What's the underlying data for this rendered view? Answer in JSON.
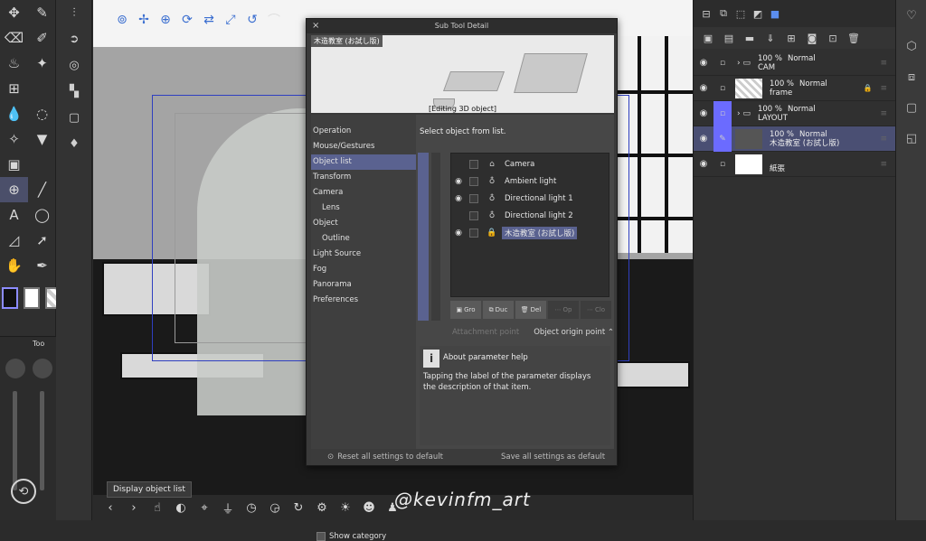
{
  "dialog": {
    "title": "Sub Tool Detail",
    "close_icon": "×",
    "preview_name": "木造教室 (お試し版)",
    "preview_label": "[Editing 3D object]",
    "categories": [
      {
        "label": "Operation",
        "indent": false
      },
      {
        "label": "Mouse/Gestures",
        "indent": false
      },
      {
        "label": "Object list",
        "indent": false,
        "selected": true
      },
      {
        "label": "Transform",
        "indent": false
      },
      {
        "label": "Camera",
        "indent": false
      },
      {
        "label": "Lens",
        "indent": true
      },
      {
        "label": "Object",
        "indent": false
      },
      {
        "label": "Outline",
        "indent": true
      },
      {
        "label": "Light Source",
        "indent": false
      },
      {
        "label": "Fog",
        "indent": false
      },
      {
        "label": "Panorama",
        "indent": false
      },
      {
        "label": "Preferences",
        "indent": false
      }
    ],
    "show_category": "Show category",
    "select_message": "Select object from list.",
    "objects": [
      {
        "label": "Camera",
        "icon": "camera-icon",
        "eye": false
      },
      {
        "label": "Ambient light",
        "icon": "bulb-icon",
        "eye": true
      },
      {
        "label": "Directional light 1",
        "icon": "bulb-icon",
        "eye": true
      },
      {
        "label": "Directional light 2",
        "icon": "bulb-icon",
        "eye": false
      },
      {
        "label": "木造教室 (お試し版)",
        "icon": "lock-icon",
        "eye": true,
        "selected": true
      }
    ],
    "object_buttons": [
      {
        "label": "Gro",
        "disabled": false
      },
      {
        "label": "Duc",
        "disabled": false
      },
      {
        "label": "Del",
        "disabled": false
      },
      {
        "label": "Op",
        "disabled": true
      },
      {
        "label": "Clo",
        "disabled": true
      }
    ],
    "attachment_label": "Attachment point",
    "attachment_value": "Object origin point",
    "help_title": "About parameter help",
    "help_desc": "Tapping the label of the parameter displays the description of that item.",
    "reset_all": "Reset all settings to default",
    "save_all": "Save all settings as default"
  },
  "layers": [
    {
      "opacity": "100 %",
      "blend": "Normal",
      "name": "CAM",
      "type": "folder"
    },
    {
      "opacity": "100 %",
      "blend": "Normal",
      "name": "frame",
      "type": "raster"
    },
    {
      "opacity": "100 %",
      "blend": "Normal",
      "name": "LAYOUT",
      "type": "folder"
    },
    {
      "opacity": "100 %",
      "blend": "Normal",
      "name": "木造教室 (お試し版)",
      "type": "3d",
      "active": true
    },
    {
      "opacity": "",
      "blend": "",
      "name": "紙張",
      "type": "paper"
    }
  ],
  "left_panel": {
    "tab_label": "Too"
  },
  "tooltip": "Display object list",
  "watermark": "@kevinfm_art",
  "colors": {
    "accent": "#5a6290",
    "selection": "#6b6bff",
    "canvas_frame": "#2f3fc0"
  }
}
